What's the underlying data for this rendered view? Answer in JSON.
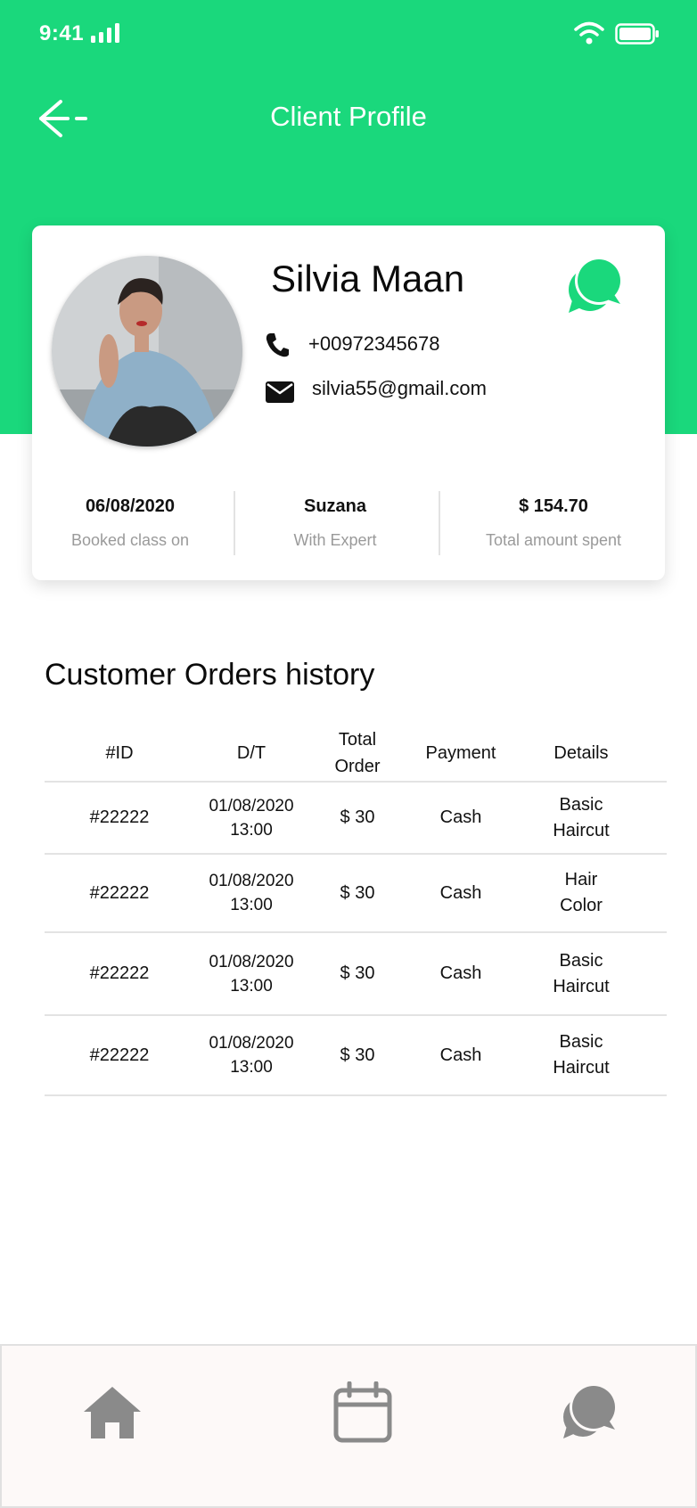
{
  "status_bar": {
    "time": "9:41"
  },
  "header": {
    "title": "Client Profile",
    "back_icon": "back-arrow-icon"
  },
  "profile": {
    "name": "Silvia Maan",
    "phone": "+00972345678",
    "email": "silvia55@gmail.com",
    "stats": [
      {
        "value": "06/08/2020",
        "label": "Booked class on"
      },
      {
        "value": "Suzana",
        "label": "With Expert"
      },
      {
        "value": "$ 154.70",
        "label": "Total amount spent"
      }
    ]
  },
  "orders": {
    "title": "Customer Orders history",
    "headers": [
      "#ID",
      "D/T",
      "Total Order",
      "Payment",
      "Details"
    ],
    "rows": [
      {
        "id": "#22222",
        "date": "01/08/2020",
        "time": "13:00",
        "total": "$ 30",
        "payment": "Cash",
        "details": "Basic Haircut"
      },
      {
        "id": "#22222",
        "date": "01/08/2020",
        "time": "13:00",
        "total": "$ 30",
        "payment": "Cash",
        "details": "Hair Color"
      },
      {
        "id": "#22222",
        "date": "01/08/2020",
        "time": "13:00",
        "total": "$ 30",
        "payment": "Cash",
        "details": "Basic Haircut"
      },
      {
        "id": "#22222",
        "date": "01/08/2020",
        "time": "13:00",
        "total": "$ 30",
        "payment": "Cash",
        "details": "Basic Haircut"
      }
    ]
  },
  "bottom_nav": {
    "items": [
      "home-icon",
      "calendar-icon",
      "chat-icon"
    ]
  },
  "colors": {
    "brand_green": "#1ad87c",
    "nav_gray": "#8a8a8a"
  }
}
